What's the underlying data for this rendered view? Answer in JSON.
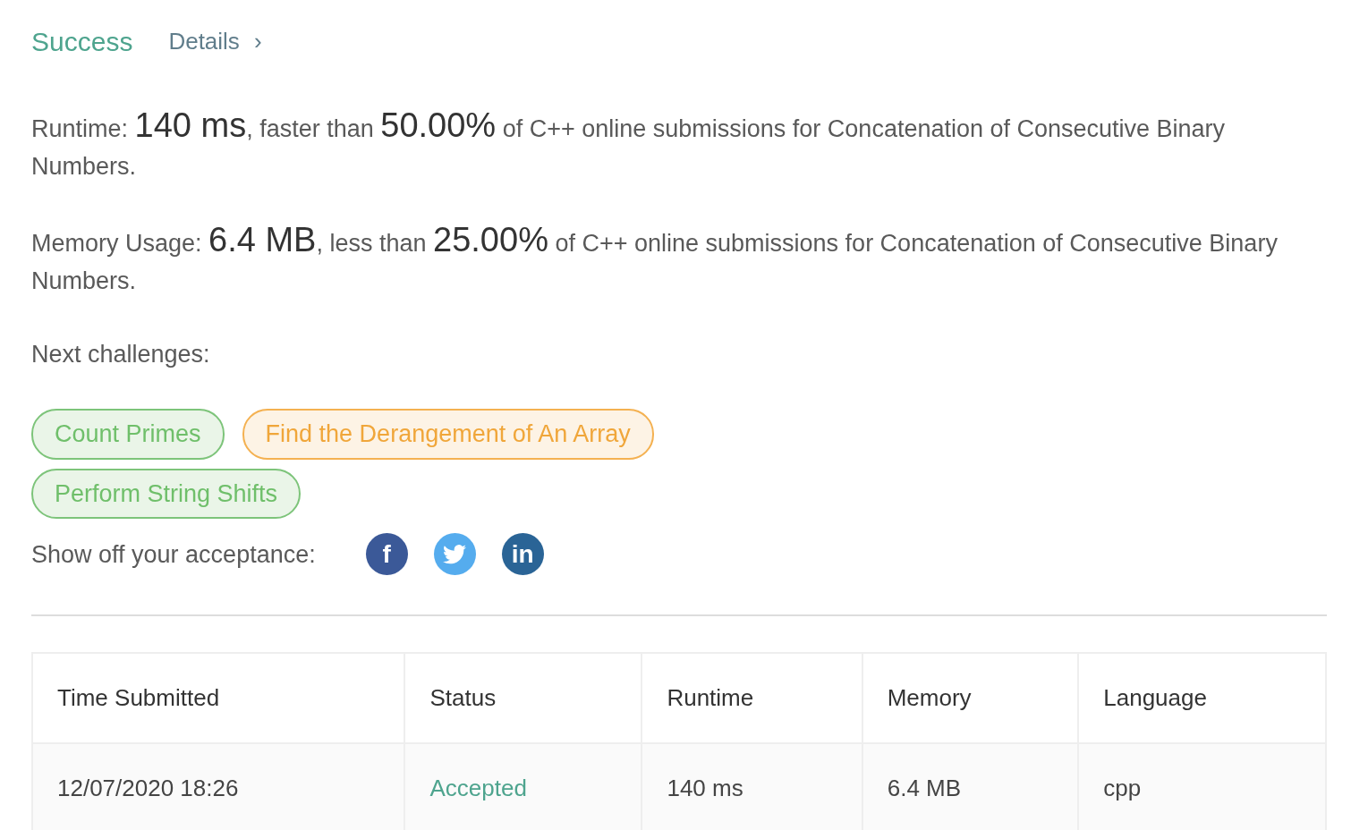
{
  "header": {
    "title": "Success",
    "details_link": "Details",
    "chevron": "›"
  },
  "results": [
    {
      "label": "Runtime:",
      "value": "140 ms",
      "comparison": ", faster than",
      "percent": "50.00%",
      "rest": "of C++ online submissions for Concatenation of Consecutive Binary Numbers."
    },
    {
      "label": "Memory Usage:",
      "value": "6.4 MB",
      "comparison": ", less than",
      "percent": "25.00%",
      "rest": "of C++ online submissions for Concatenation of Consecutive Binary Numbers."
    }
  ],
  "next_challenges": {
    "label": "Next challenges:",
    "items": [
      {
        "title": "Count Primes",
        "kind": "easy"
      },
      {
        "title": "Find the Derangement of An Array",
        "kind": "medium"
      },
      {
        "title": "Perform String Shifts",
        "kind": "easy"
      }
    ]
  },
  "share": {
    "label": "Show off your acceptance:",
    "buttons": [
      {
        "kind": "facebook",
        "glyph": "f"
      },
      {
        "kind": "twitter"
      },
      {
        "kind": "linkedin",
        "glyph": "in"
      }
    ]
  },
  "table": {
    "columns": [
      "Time Submitted",
      "Status",
      "Runtime",
      "Memory",
      "Language"
    ],
    "rows": [
      {
        "time": "12/07/2020 18:26",
        "status": "Accepted",
        "accepted": true,
        "runtime": "140 ms",
        "memory": "6.4 MB",
        "language": "cpp"
      }
    ]
  }
}
